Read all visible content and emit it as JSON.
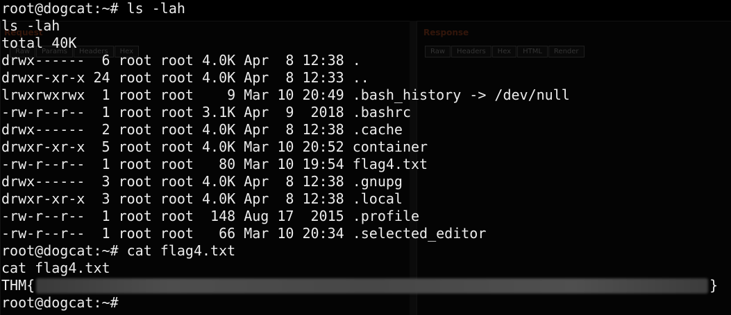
{
  "terminal": {
    "prompt": "root@dogcat:~# ",
    "commands": {
      "ls_typed": "ls -lah",
      "ls_echo": "ls -lah",
      "total": "total 40K",
      "cat_typed": "cat flag4.txt",
      "cat_echo": "cat flag4.txt"
    },
    "listing": [
      "drwx------  6 root root 4.0K Apr  8 12:38 .",
      "drwxr-xr-x 24 root root 4.0K Apr  8 12:33 ..",
      "lrwxrwxrwx  1 root root    9 Mar 10 20:49 .bash_history -> /dev/null",
      "-rw-r--r--  1 root root 3.1K Apr  9  2018 .bashrc",
      "drwx------  2 root root 4.0K Apr  8 12:38 .cache",
      "drwxr-xr-x  5 root root 4.0K Mar 10 20:52 container",
      "-rw-r--r--  1 root root   80 Mar 10 19:54 flag4.txt",
      "drwx------  3 root root 4.0K Apr  8 12:38 .gnupg",
      "drwxr-xr-x  3 root root 4.0K Apr  8 12:38 .local",
      "-rw-r--r--  1 root root  148 Aug 17  2015 .profile",
      "-rw-r--r--  1 root root   66 Mar 10 20:34 .selected_editor"
    ],
    "flag": {
      "prefix": "THM{",
      "suffix": "}"
    }
  },
  "background_window": {
    "request_title": "Request",
    "response_title": "Response",
    "request_tabs": [
      "Raw",
      "Params",
      "Headers",
      "Hex"
    ],
    "response_tabs": [
      "Raw",
      "Headers",
      "Hex",
      "HTML",
      "Render"
    ]
  }
}
